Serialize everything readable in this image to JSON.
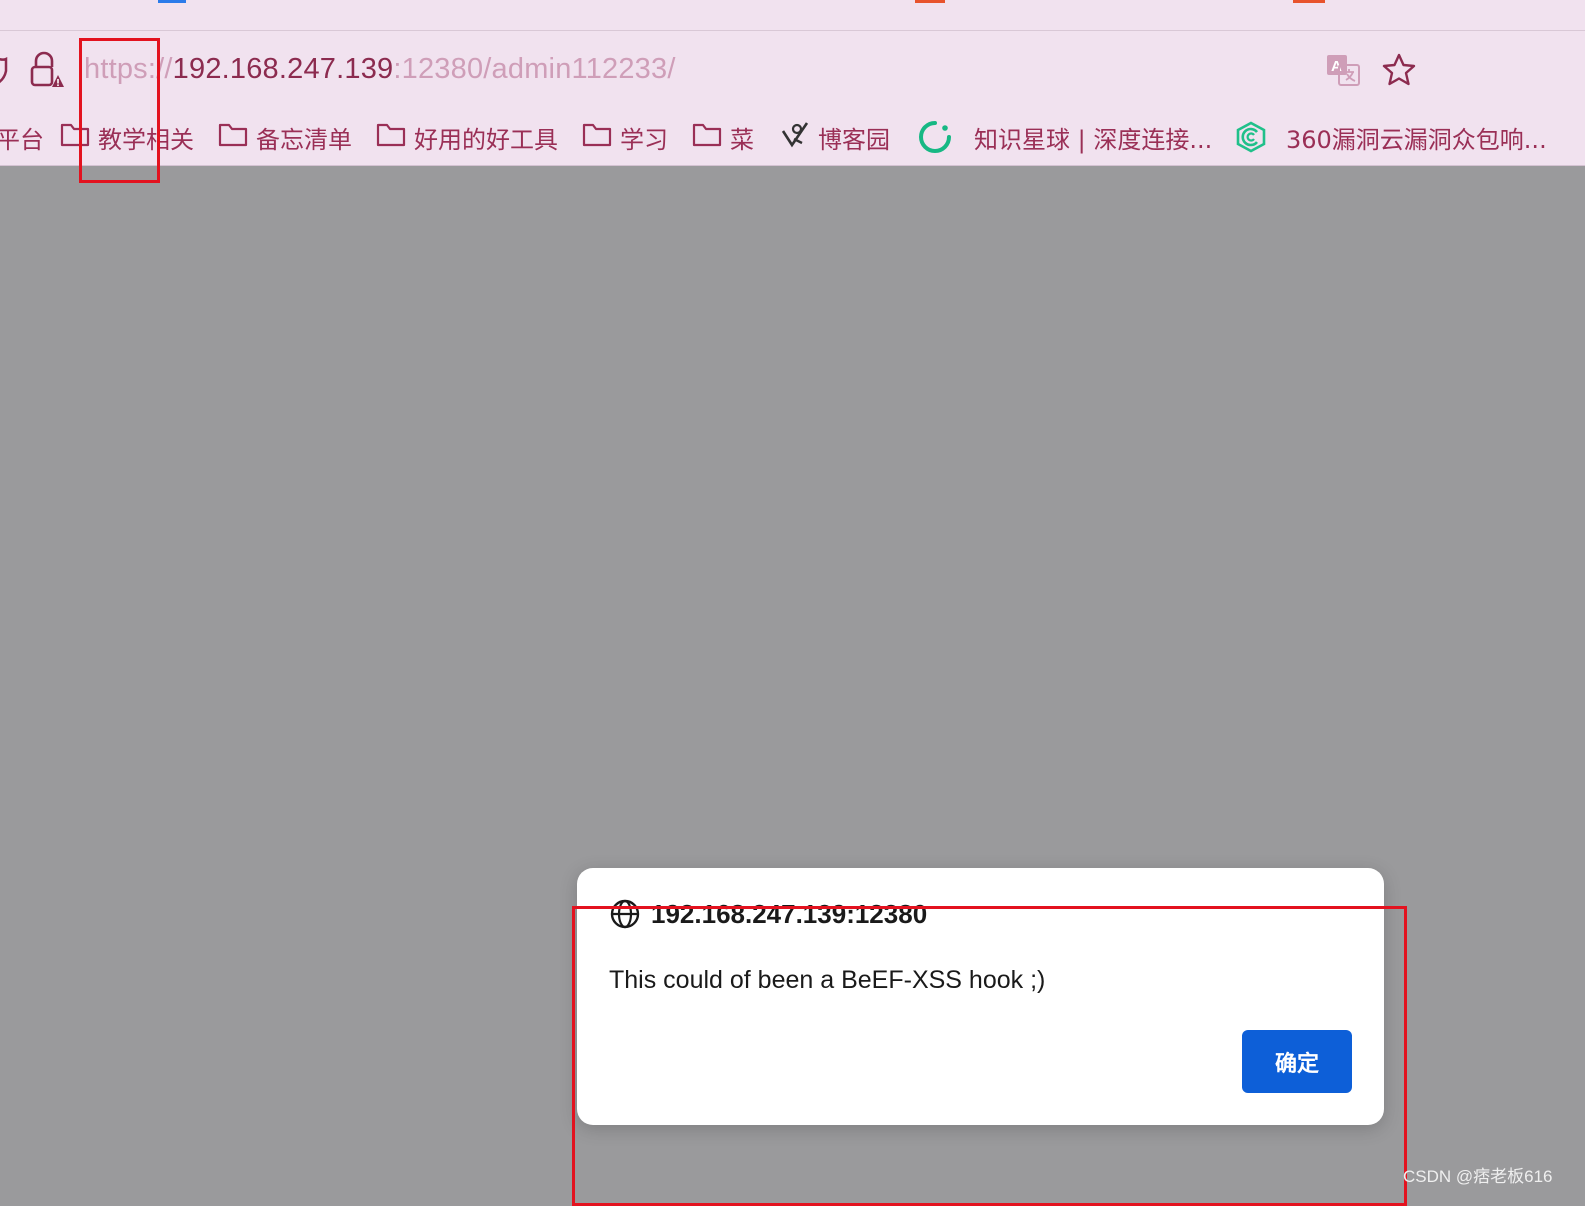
{
  "address_bar": {
    "scheme": "https://",
    "host": "192.168.247.139",
    "rest": ":12380/admin112233/"
  },
  "bookmarks": [
    {
      "label": "平台",
      "icon": "none"
    },
    {
      "label": "教学相关",
      "icon": "folder-icon"
    },
    {
      "label": "备忘清单",
      "icon": "folder-icon"
    },
    {
      "label": "好用的好工具",
      "icon": "folder-icon"
    },
    {
      "label": "学习",
      "icon": "folder-icon"
    },
    {
      "label": "菜",
      "icon": "folder-icon"
    },
    {
      "label": "博客园",
      "icon": "cnblogs-icon"
    },
    {
      "label": "知识星球 | 深度连接...",
      "icon": "zsxq-icon"
    },
    {
      "label": "360漏洞云漏洞众包响...",
      "icon": "360-icon"
    }
  ],
  "dialog": {
    "origin": "192.168.247.139:12380",
    "message": "This could of been a BeEF-XSS hook ;)",
    "ok_label": "确定"
  },
  "watermark": "CSDN @痞老板616",
  "colors": {
    "chrome_bg": "#f1e2ef",
    "bookmark_text": "#9a2f56",
    "ok_button": "#0d5fd8",
    "annotation_red": "#e3121f",
    "page_overlay": "#9a9a9c"
  }
}
